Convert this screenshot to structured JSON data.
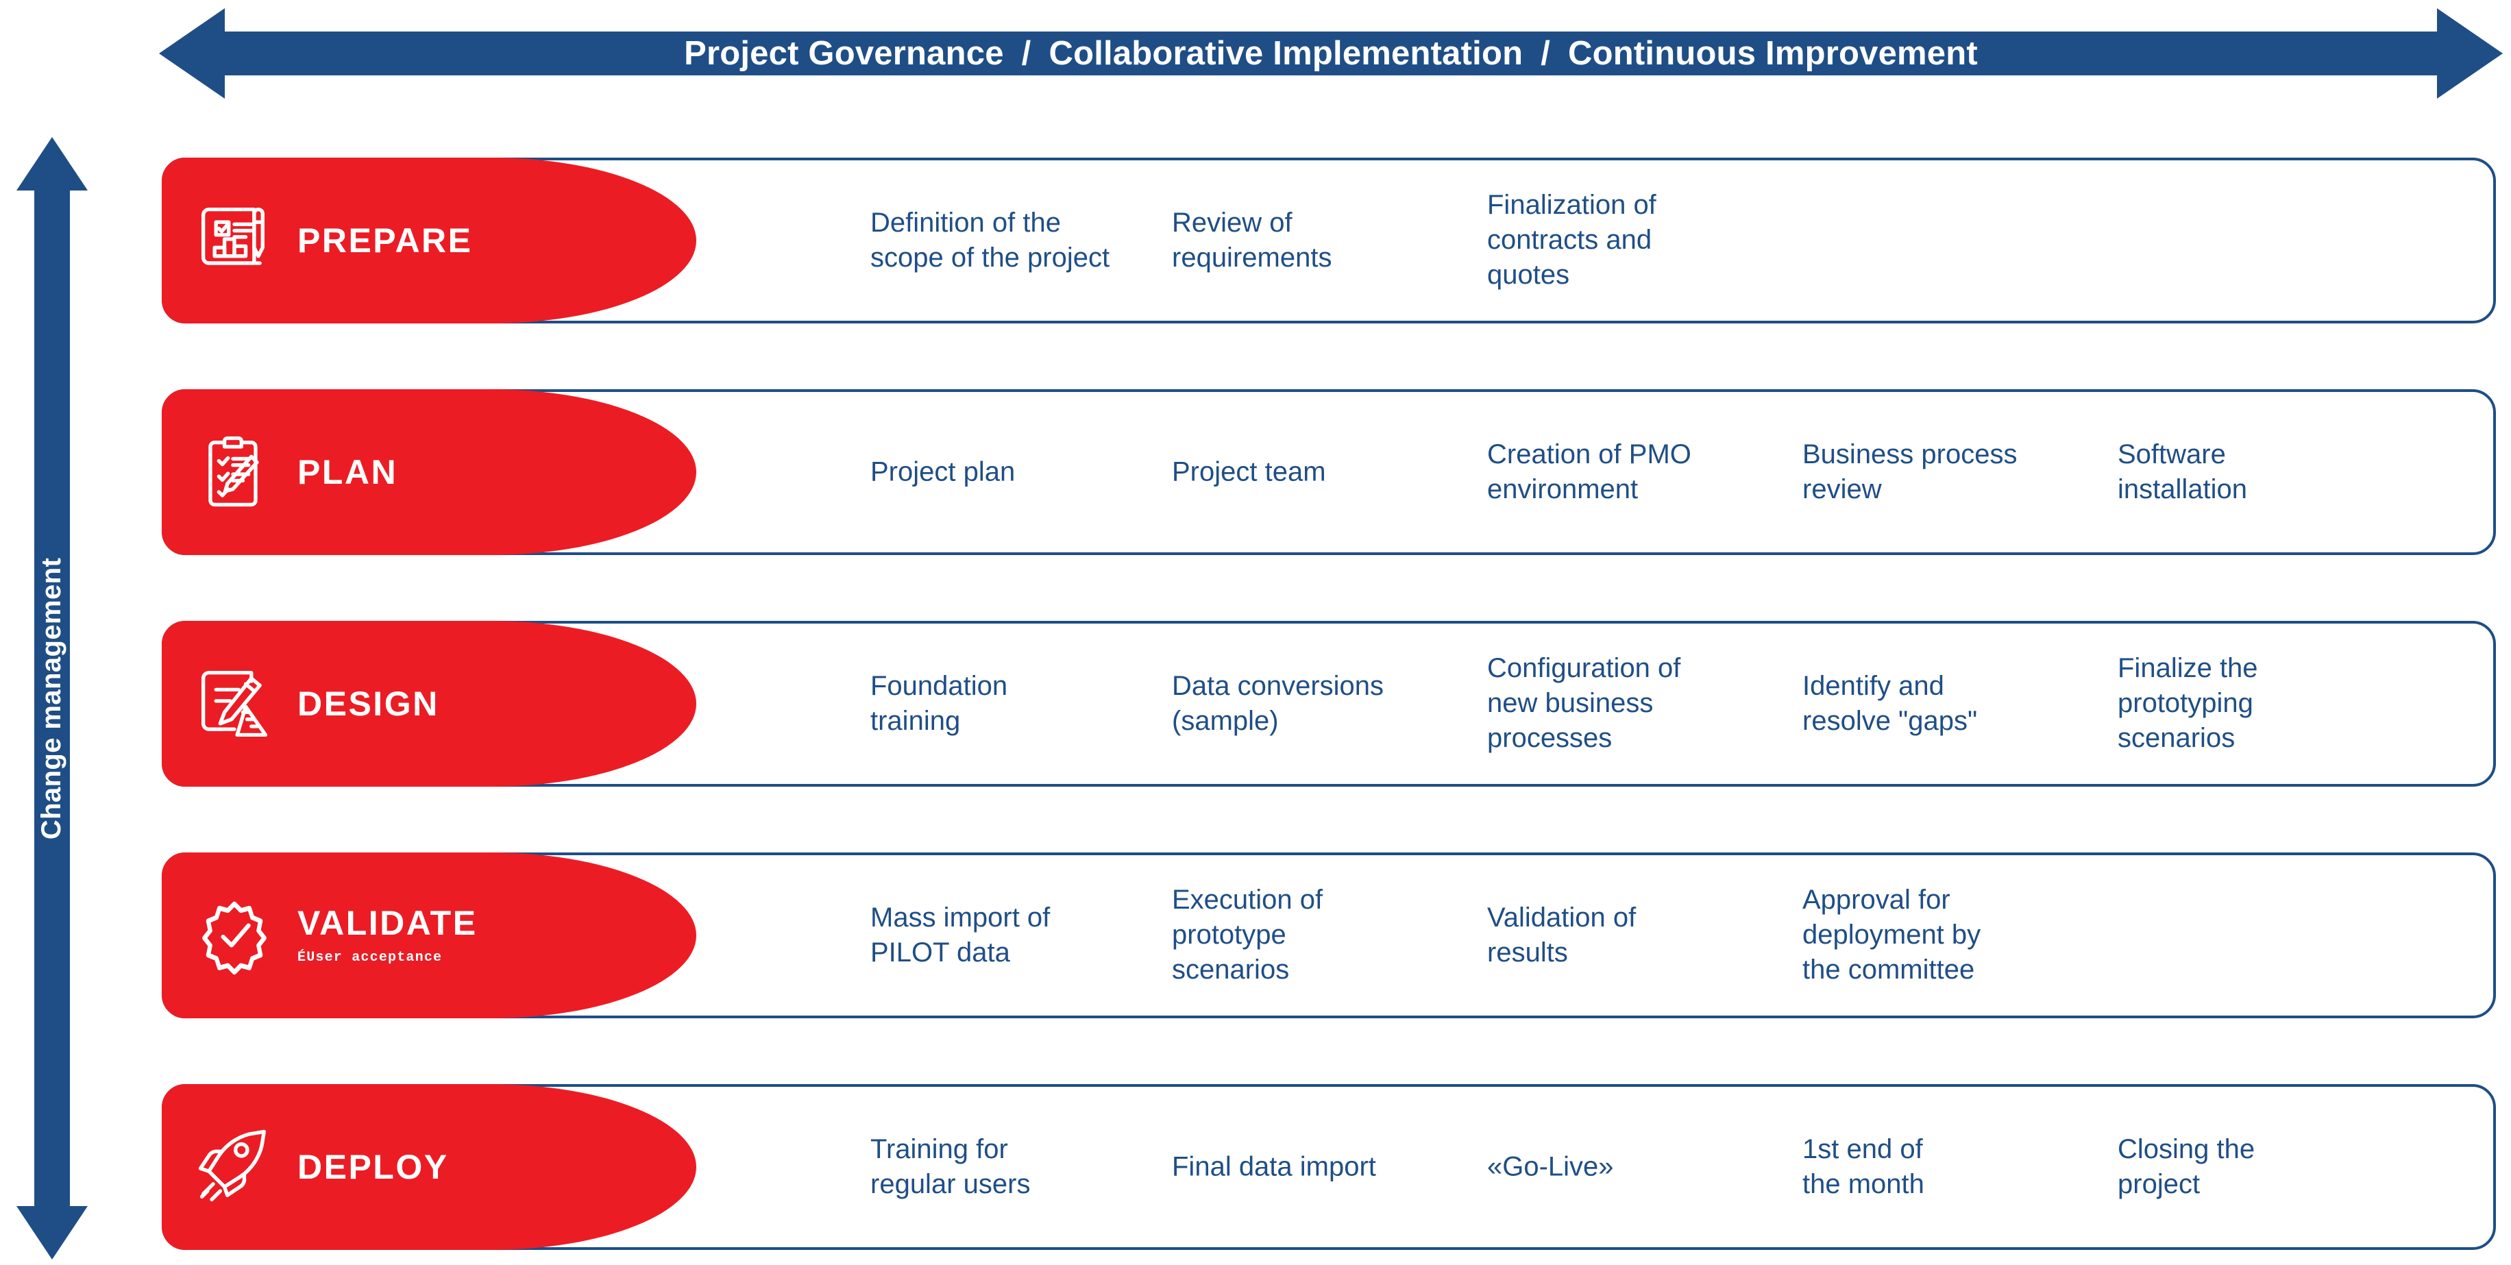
{
  "top_banner": {
    "segments": [
      "Project Governance",
      "Collaborative Implementation",
      "Continuous Improvement"
    ],
    "separator": "/",
    "full_text": "Project Governance / Collaborative Implementation / Continuous Improvement"
  },
  "left_banner": {
    "label": "Change management"
  },
  "colors": {
    "brand_blue": "#1F4E86",
    "brand_red": "#EC1C24",
    "white": "#FFFFFF"
  },
  "phases": [
    {
      "title": "PREPARE",
      "subtitle": "",
      "icon": "blueprint-icon",
      "steps": [
        "Definition of the\nscope of the project",
        "Review of\nrequirements",
        "Finalization of\ncontracts and\nquotes",
        "",
        ""
      ]
    },
    {
      "title": "PLAN",
      "subtitle": "",
      "icon": "clipboard-checklist-icon",
      "steps": [
        "Project plan",
        "Project team",
        "Creation of PMO\nenvironment",
        "Business process\nreview",
        "Software\ninstallation"
      ]
    },
    {
      "title": "DESIGN",
      "subtitle": "",
      "icon": "drafting-ruler-pencil-icon",
      "steps": [
        "Foundation\ntraining",
        "Data conversions\n(sample)",
        "Configuration of\nnew business\nprocesses",
        "Identify and\nresolve \"gaps\"",
        "Finalize the\nprototyping\nscenarios"
      ]
    },
    {
      "title": "VALIDATE",
      "subtitle": "ÉUser acceptance",
      "icon": "badge-check-icon",
      "steps": [
        "Mass import of\nPILOT data",
        "Execution of\nprototype\nscenarios",
        "Validation of\nresults",
        "Approval for\ndeployment by\nthe committee",
        ""
      ]
    },
    {
      "title": "DEPLOY",
      "subtitle": "",
      "icon": "rocket-icon",
      "steps": [
        "Training for\nregular users",
        "Final data import",
        "«Go-Live»",
        "1st end of\nthe month",
        "Closing the\nproject"
      ]
    }
  ]
}
